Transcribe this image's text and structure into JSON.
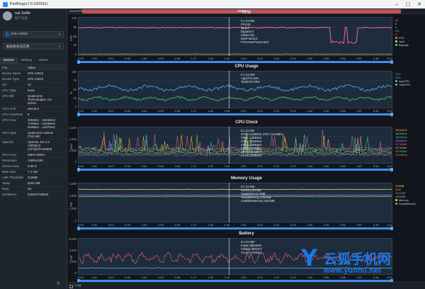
{
  "window": {
    "title": "PerfDog(v7.0.220332)"
  },
  "user": {
    "name": "nat Sellfe",
    "subtitle": "账户信息"
  },
  "device_select": {
    "value": "ZTE A2023"
  },
  "app_select": {
    "placeholder": "请选择测试应用"
  },
  "tabs": [
    {
      "label": "Device"
    },
    {
      "label": "Setting"
    },
    {
      "label": "About"
    }
  ],
  "info": {
    "header": {
      "k": "Info",
      "v": "Value"
    },
    "rows": [
      {
        "k": "Device Name",
        "v": "ZTE A2023"
      },
      {
        "k": "Device Type",
        "v": "ZTE A2023"
      },
      {
        "k": "OS",
        "v": "12"
      },
      {
        "k": "CPU Type",
        "v": "kona"
      },
      {
        "k": "CPU Mfr",
        "v": "Qualcomm\nTechnologies, Inc\nKONA"
      },
      {
        "k": "CPU Arch",
        "v": "armv8-a"
      },
      {
        "k": "CPU CoreNum",
        "v": "8"
      },
      {
        "k": "CPU Freq",
        "v": "300MHz - 1804MHz\n710MHz - 2419MHz\n844MHz - 3187MHz"
      },
      {
        "k": "GPU Type",
        "v": "Qualcomm Adreno\n(TM) 650"
      },
      {
        "k": "OpenGL",
        "v": "OpenGL ES 3.2\nV@502.0\n(GIT@d7428d69)"
      },
      {
        "k": "GPU Freq",
        "v": "0MHz-0MHz"
      },
      {
        "k": "Resolution",
        "v": "1080x2400"
      },
      {
        "k": "Screen Size",
        "v": "6.68 in"
      },
      {
        "k": "Ram Size",
        "v": "7.4 GB"
      },
      {
        "k": "LMK Threshold",
        "v": "216MB"
      },
      {
        "k": "Swap",
        "v": "8191 MB"
      },
      {
        "k": "Root",
        "v": "No"
      },
      {
        "k": "SerialNum",
        "v": "5205247d6640"
      }
    ]
  },
  "topbar": {
    "scene": "Scene/TBE",
    "label": "label1"
  },
  "x_ticks": [
    "0:00",
    "0:11",
    "0:22",
    "0:33",
    "0:44",
    "0:55",
    "1:06",
    "1:17",
    "1:28",
    "1:39",
    "1:50",
    "2:01",
    "2:12",
    "2:23",
    "2:34",
    "2:45",
    "2:56",
    "3:07",
    "3:18",
    "3:24"
  ],
  "fps": {
    "title": "FPS",
    "unit": "FPS",
    "tip": [
      "0:1:41:000",
      "FPS:60",
      "Jank:0",
      "BigJank:0",
      "Stutter:0%",
      "InterFrame:0",
      "FPS>InterFrame:59.8"
    ],
    "legend": [
      {
        "t": "60",
        "c": "#ff5fa2"
      },
      {
        "t": "0",
        "c": "#ffd84a"
      },
      {
        "t": "0",
        "c": "#5ae36b"
      },
      {
        "t": "0%",
        "c": "#47b6ff"
      },
      {
        "t": "0",
        "c": "#c57cff"
      }
    ],
    "legend_names": [
      {
        "t": "FPS",
        "c": "#ff5fa2"
      },
      {
        "t": "Jank",
        "c": "#ffd84a"
      },
      {
        "t": "BigJank",
        "c": "#5ae36b"
      }
    ],
    "y_ticks": [
      "120",
      "90",
      "60",
      "30",
      "0"
    ]
  },
  "cpu": {
    "title": "CPU Usage",
    "unit": "%",
    "tip": [
      "0:1:41:000",
      "AppCPU:16%",
      "TotalCPU:38%"
    ],
    "legend": [
      {
        "t": "11%",
        "c": "#47d36b"
      },
      {
        "t": "29%",
        "c": "#5ab2ff"
      }
    ],
    "legend_names": [
      {
        "t": "AppCPU",
        "c": "#47d36b"
      },
      {
        "t": "TotalCPU",
        "c": "#5ab2ff"
      }
    ],
    "y_ticks": [
      "100",
      "75",
      "50",
      "25",
      "0"
    ]
  },
  "clock": {
    "title": "CPU Clock",
    "unit": "MHz",
    "tip": [
      "0:1:41:000",
      "CPU0:1363MHz CPU7:2419MHz",
      "CPU1:1363MHz",
      "CPU2:1363MHz",
      "CPU3:1363MHz",
      "CPU4:1670MHz",
      "CPU5:1670MHz",
      "CPU6:1670MHz"
    ],
    "legend": [
      {
        "t": "1804MHz",
        "c": "#ffb347"
      },
      {
        "t": "1804MHz",
        "c": "#5ae36b"
      },
      {
        "t": "1804MHz",
        "c": "#47b6ff"
      },
      {
        "t": "1804MHz",
        "c": "#c57cff"
      },
      {
        "t": "1171MHz",
        "c": "#ff5fa2"
      },
      {
        "t": "1171MHz",
        "c": "#ffd84a"
      },
      {
        "t": "1171MHz",
        "c": "#46e0d5"
      },
      {
        "t": "2419MHz",
        "c": "#ff7a4a"
      }
    ],
    "y_ticks": [
      "3,000",
      "2,000",
      "1,000",
      "0"
    ]
  },
  "memory": {
    "title": "Memory Usage",
    "unit": "MB",
    "tip": [
      "0:1:41:000",
      "Memory:401MB",
      "SwapMemory:2MB",
      "VirtualMemory:2451MB",
      "AvailableMemory:2451MB"
    ],
    "legend": [
      {
        "t": "316MB",
        "c": "#ffd84a"
      },
      {
        "t": "2MB",
        "c": "#ff7a4a"
      },
      {
        "t": "2421MB",
        "c": "#c57cff"
      },
      {
        "t": "2433MB",
        "c": "#5ae36b"
      }
    ],
    "legend_names": [
      {
        "t": "Memory",
        "c": "#ffd84a"
      },
      {
        "t": "SwapMemory",
        "c": "#ff7a4a"
      }
    ],
    "y_ticks": [
      "3,000",
      "2,000",
      "1,000",
      "0"
    ]
  },
  "battery": {
    "title": "Battery",
    "unit": "mW",
    "tip": [
      "0:1:41:000",
      "Power:3854mW",
      "Voltage:3942mV",
      "Current:1000mA"
    ],
    "y_ticks": [
      "6,000",
      "4,000",
      "2,000",
      "0"
    ]
  },
  "logbar": {
    "label": "Log"
  },
  "watermark": {
    "big": "Y",
    "cn": "云狐手机网",
    "url": "www.yunhu.net"
  },
  "colors": {
    "accent": "#1e8cff",
    "label_bar": "#b8545c",
    "chart_bg": "#1d2b3a"
  }
}
